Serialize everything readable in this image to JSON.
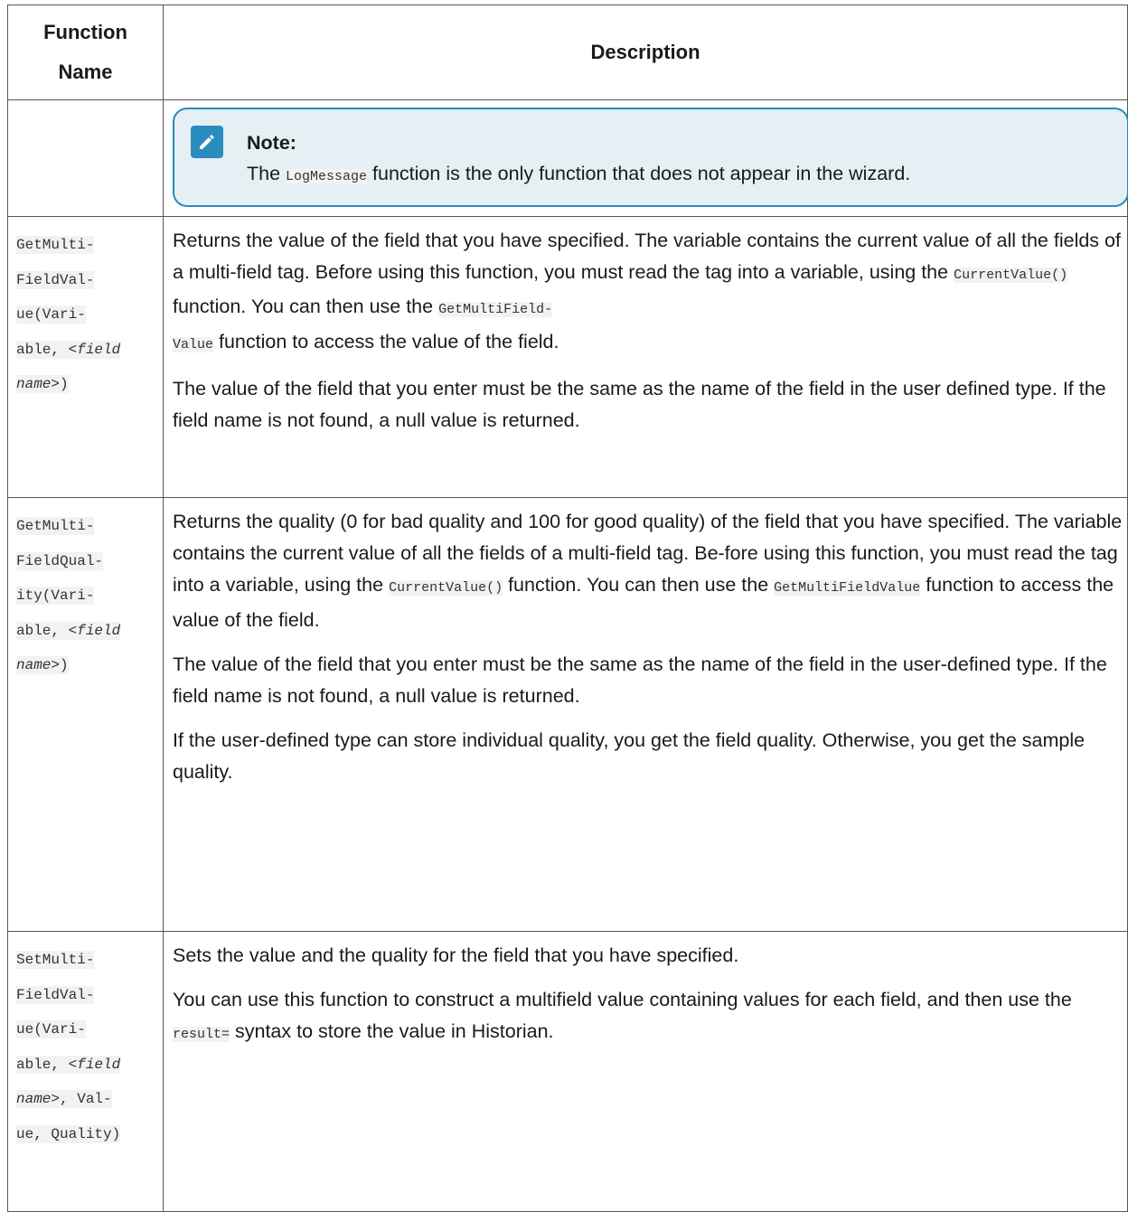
{
  "headers": {
    "function_name": "Function Name",
    "description": "Description"
  },
  "note": {
    "title": "Note:",
    "text_before": "The",
    "code": "LogMessage",
    "text_after": "function is the only function that does not appear in the wizard."
  },
  "rows": [
    {
      "fn_lines": [
        "GetMulti-",
        "FieldVal-",
        "ue(Vari-",
        "able, ",
        "<field",
        "name>",
        ")"
      ],
      "desc": {
        "p1_a": "Returns the value of the field that you have specified. The variable contains the current value of all the fields of a multi-field tag. Before using this function, you must read the tag into a variable, using the",
        "p1_code1": "CurrentValue()",
        "p1_b": "function. You can then use the",
        "p1_code2a": "GetMultiField-",
        "p1_code2b": "Value",
        "p1_c": "function to access the value of the field.",
        "p2": "The value of the field that you enter must be the same as the name of the field in the user defined type. If the field name is not found, a null value is returned."
      }
    },
    {
      "fn_lines": [
        "GetMulti-",
        "FieldQual-",
        "ity(Vari-",
        "able, ",
        "<field",
        "name>",
        ")"
      ],
      "desc": {
        "p1_a": "Returns the quality (0 for bad quality and 100 for good quality) of the field that you have specified. The variable contains the current value of all the fields of a multi-field tag. Be-fore using this function, you must read the tag into a variable, using the",
        "p1_code1": "CurrentValue()",
        "p1_b": "function. You can then use the",
        "p1_code2": "GetMultiFieldValue",
        "p1_c": "function to access the value of the field.",
        "p2": "The value of the field that you enter must be the same as the name of the field in the user-defined type. If the field name is not found, a null value is returned.",
        "p3": "If the user-defined type can store individual quality, you get the field quality. Otherwise, you get the sample quality."
      }
    },
    {
      "fn_lines": [
        "SetMulti-",
        "FieldVal-",
        "ue(Vari-",
        "able, ",
        "<field",
        "name>",
        ", Val-",
        "ue, Quality)"
      ],
      "desc": {
        "p1": "Sets the value and the quality for the field that you have specified.",
        "p2_a": "You can use this function to construct a multifield value containing values for each field, and then use the",
        "p2_code": "result=",
        "p2_b": "syntax to store the value in Historian."
      }
    }
  ]
}
